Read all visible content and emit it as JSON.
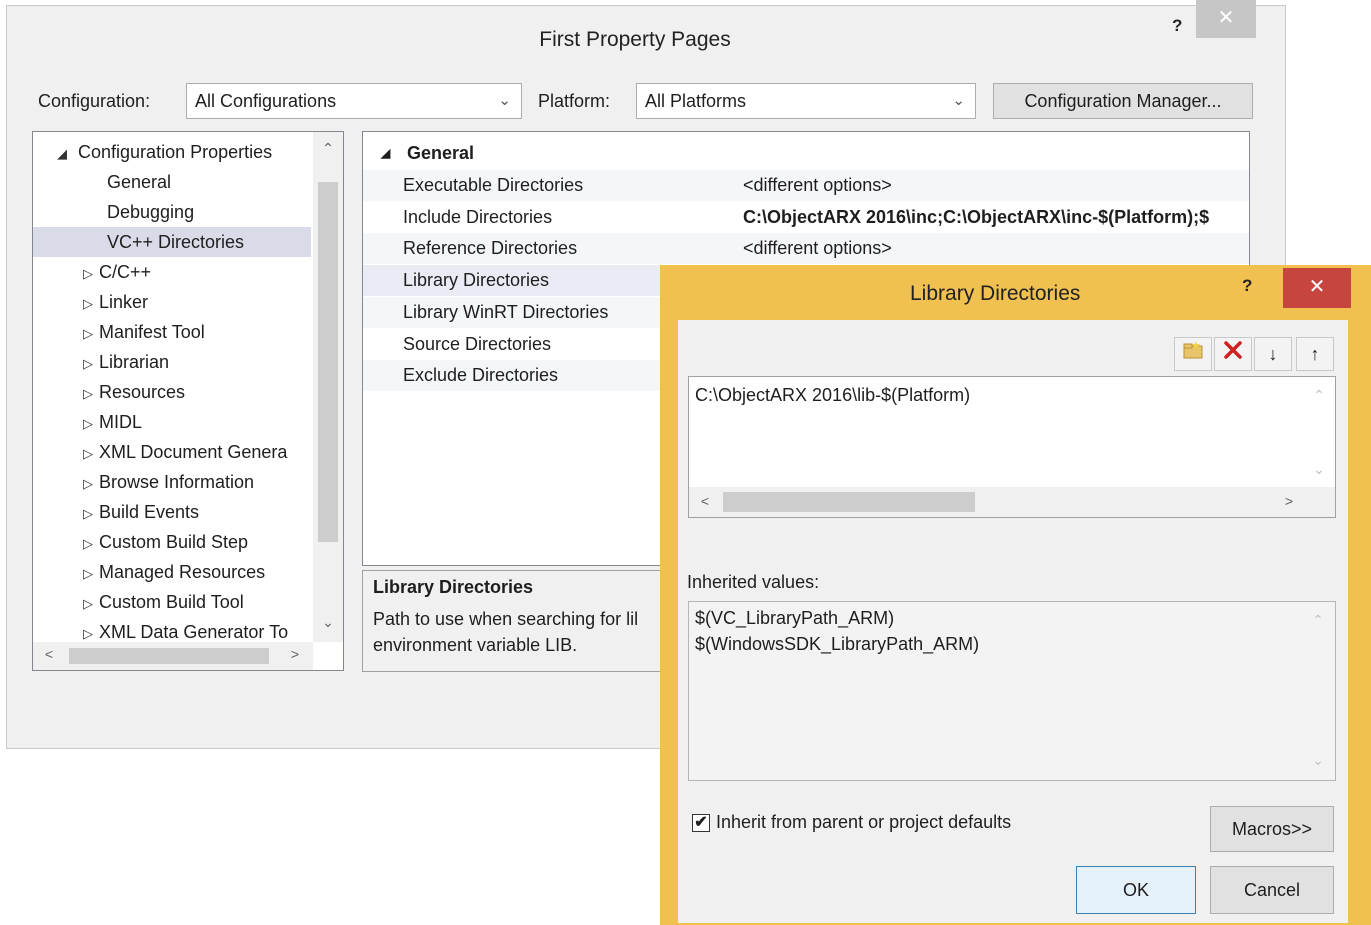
{
  "main_window": {
    "title": "First Property Pages",
    "help": "?",
    "close": "✕",
    "configuration_label": "Configuration:",
    "configuration_value": "All Configurations",
    "platform_label": "Platform:",
    "platform_value": "All Platforms",
    "config_manager_button": "Configuration Manager..."
  },
  "tree": {
    "root": "Configuration Properties",
    "items": [
      {
        "label": "General",
        "expandable": false
      },
      {
        "label": "Debugging",
        "expandable": false
      },
      {
        "label": "VC++ Directories",
        "expandable": false,
        "selected": true
      },
      {
        "label": "C/C++",
        "expandable": true
      },
      {
        "label": "Linker",
        "expandable": true
      },
      {
        "label": "Manifest Tool",
        "expandable": true
      },
      {
        "label": "Librarian",
        "expandable": true
      },
      {
        "label": "Resources",
        "expandable": true
      },
      {
        "label": "MIDL",
        "expandable": true
      },
      {
        "label": "XML Document Genera",
        "expandable": true
      },
      {
        "label": "Browse Information",
        "expandable": true
      },
      {
        "label": "Build Events",
        "expandable": true
      },
      {
        "label": "Custom Build Step",
        "expandable": true
      },
      {
        "label": "Managed Resources",
        "expandable": true
      },
      {
        "label": "Custom Build Tool",
        "expandable": true
      },
      {
        "label": "XML Data Generator To",
        "expandable": true
      }
    ]
  },
  "grid": {
    "section": "General",
    "rows": [
      {
        "name": "Executable Directories",
        "value": "<different options>"
      },
      {
        "name": "Include Directories",
        "value": "C:\\ObjectARX 2016\\inc;C:\\ObjectARX\\inc-$(Platform);$",
        "bold": true
      },
      {
        "name": "Reference Directories",
        "value": "<different options>"
      },
      {
        "name": "Library Directories",
        "value": ""
      },
      {
        "name": "Library WinRT Directories",
        "value": ""
      },
      {
        "name": "Source Directories",
        "value": ""
      },
      {
        "name": "Exclude Directories",
        "value": ""
      }
    ]
  },
  "description": {
    "title": "Library Directories",
    "line1": "Path to use when searching for lil",
    "line2": "environment variable LIB."
  },
  "lib_dialog": {
    "title": "Library Directories",
    "help": "?",
    "close": "✕",
    "toolbar": {
      "new_line_icon": "folder-new-icon",
      "delete_icon": "delete-x-icon",
      "move_down": "↓",
      "move_up": "↑"
    },
    "edit_value": "C:\\ObjectARX 2016\\lib-$(Platform)",
    "inherited_label": "Inherited values:",
    "inherited_values": [
      "$(VC_LibraryPath_ARM)",
      "$(WindowsSDK_LibraryPath_ARM)"
    ],
    "inherit_checkbox_label": "Inherit from parent or project defaults",
    "inherit_checked": true,
    "macros_button": "Macros>>",
    "ok_button": "OK",
    "cancel_button": "Cancel"
  },
  "colors": {
    "dialog_frame": "#f0c050",
    "close_red": "#c7453f",
    "selection": "#dadbe8"
  }
}
